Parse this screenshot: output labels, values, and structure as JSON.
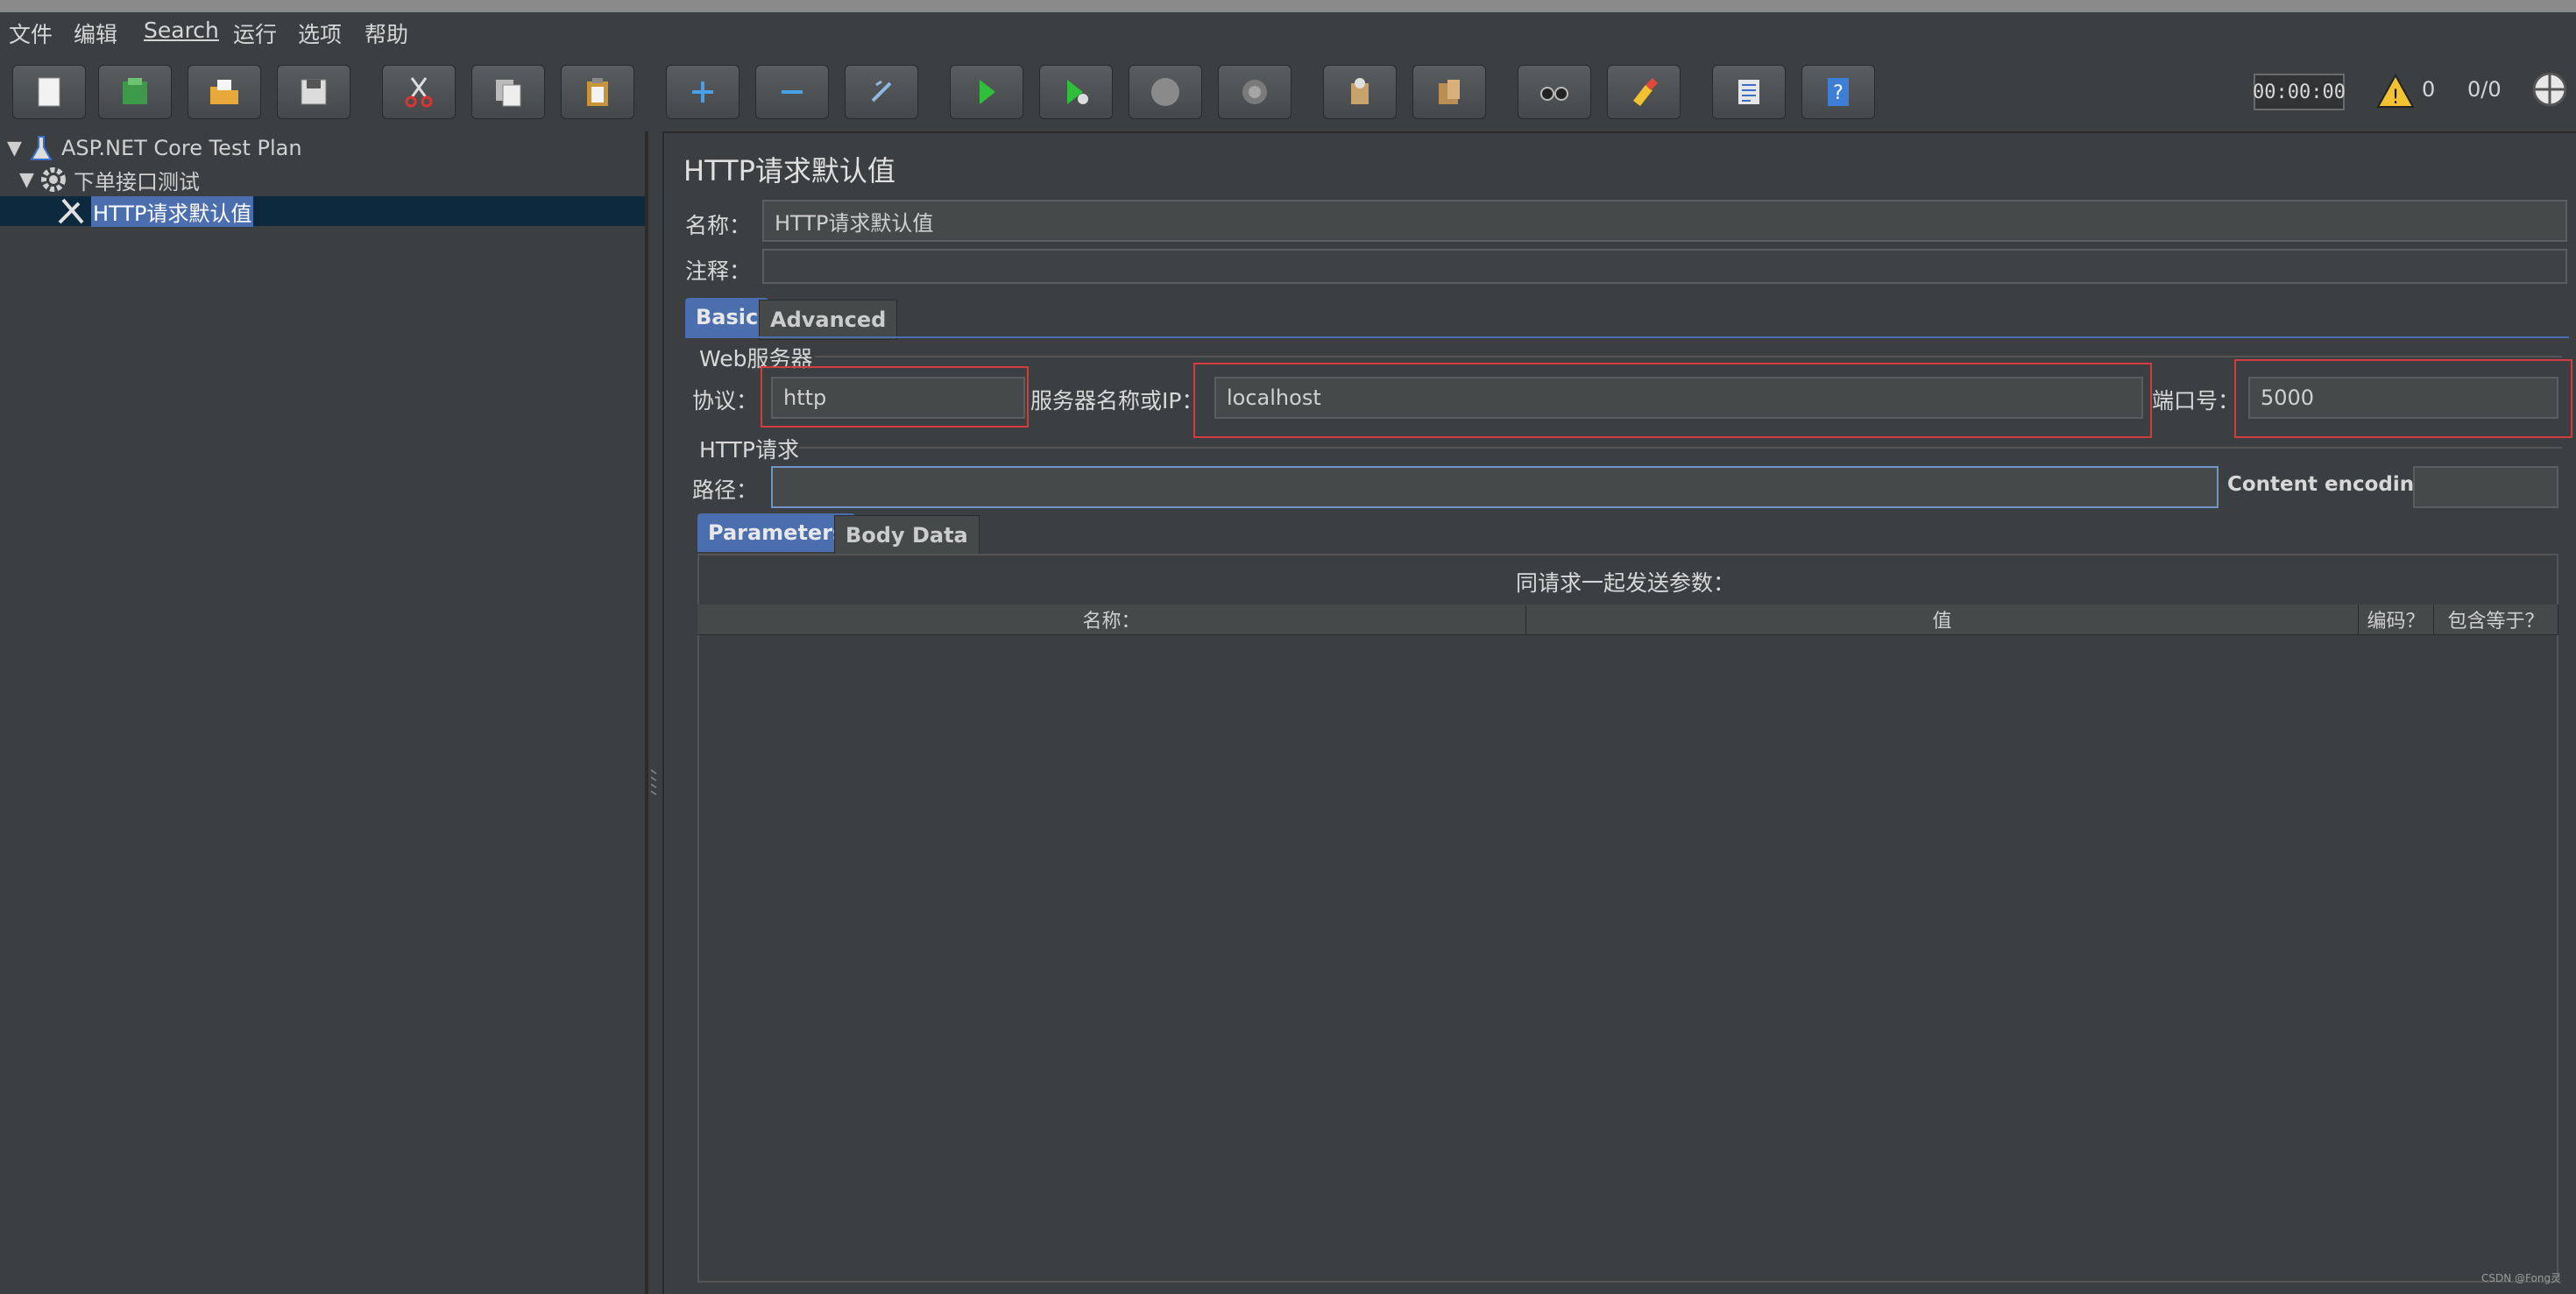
{
  "menubar": {
    "items": [
      "文件",
      "编辑",
      "Search",
      "运行",
      "选项",
      "帮助"
    ]
  },
  "toolbar": {
    "buttons": [
      {
        "icon": "new-icon"
      },
      {
        "icon": "templates-icon"
      },
      {
        "icon": "open-icon"
      },
      {
        "icon": "save-icon"
      },
      {
        "icon": "cut-icon"
      },
      {
        "icon": "copy-icon"
      },
      {
        "icon": "paste-icon"
      },
      {
        "icon": "expand-icon"
      },
      {
        "icon": "collapse-icon"
      },
      {
        "icon": "toggle-icon"
      },
      {
        "icon": "start-icon"
      },
      {
        "icon": "start-no-pause-icon"
      },
      {
        "icon": "stop-icon"
      },
      {
        "icon": "shutdown-icon"
      },
      {
        "icon": "clear-icon"
      },
      {
        "icon": "clear-all-icon"
      },
      {
        "icon": "search-icon"
      },
      {
        "icon": "reset-search-icon"
      },
      {
        "icon": "function-helper-icon"
      },
      {
        "icon": "help-icon"
      }
    ],
    "timer": "00:00:00",
    "warnings": "0",
    "threads": "0/0"
  },
  "tree": {
    "items": [
      {
        "label": "ASP.NET Core Test Plan",
        "icon": "test-plan-icon"
      },
      {
        "label": "下单接口测试",
        "icon": "thread-group-icon"
      },
      {
        "label": "HTTP请求默认值",
        "icon": "config-element-icon",
        "selected": true
      }
    ]
  },
  "panel": {
    "title": "HTTP请求默认值",
    "name_label": "名称：",
    "name_value": "HTTP请求默认值",
    "comment_label": "注释：",
    "comment_value": "",
    "tabs": [
      "Basic",
      "Advanced"
    ],
    "web_server": {
      "group_title": "Web服务器",
      "protocol_label": "协议：",
      "protocol_value": "http",
      "server_label": "服务器名称或IP：",
      "server_value": "localhost",
      "port_label": "端口号：",
      "port_value": "5000"
    },
    "http_request": {
      "group_title": "HTTP请求",
      "path_label": "路径：",
      "path_value": "",
      "encoding_label": "Content encoding:",
      "encoding_value": ""
    },
    "param_tabs": [
      "Parameters",
      "Body Data"
    ],
    "params_caption": "同请求一起发送参数：",
    "columns": [
      "名称：",
      "值",
      "编码？",
      "包含等于？"
    ]
  },
  "watermark": "CSDN @Fong灵"
}
